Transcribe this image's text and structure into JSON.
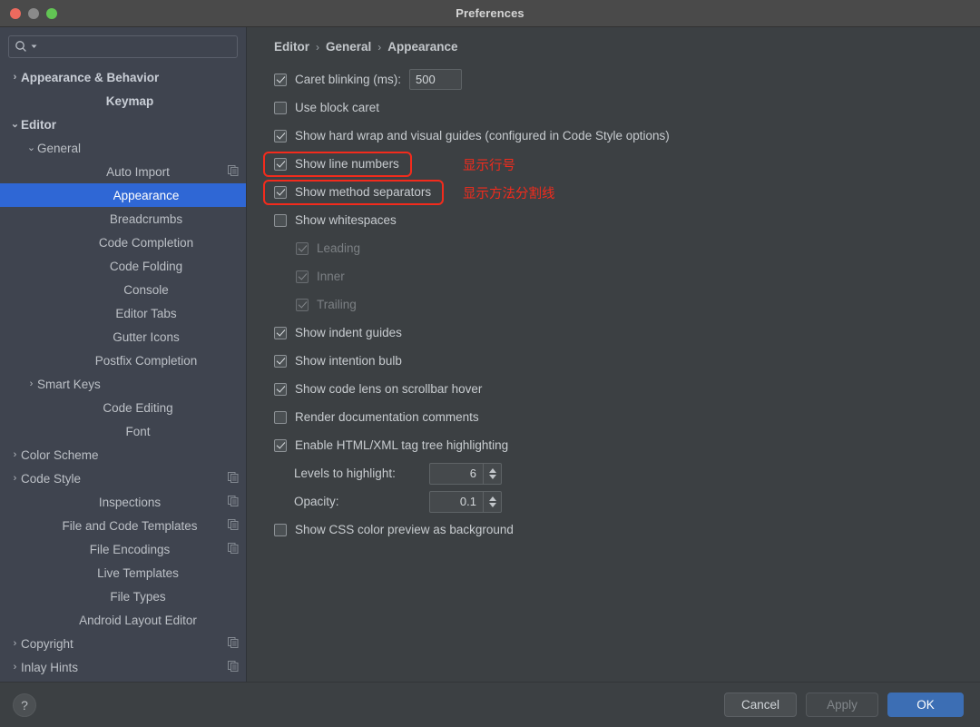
{
  "window": {
    "title": "Preferences",
    "traffic_lights": [
      "close-red",
      "minimize-gray",
      "zoom-green"
    ]
  },
  "sidebar": {
    "search": {
      "value": "",
      "placeholder": ""
    },
    "items": [
      {
        "label": "Appearance & Behavior",
        "indent": 0,
        "arrow": "collapsed",
        "bold": true,
        "selected": false,
        "copy": false
      },
      {
        "label": "Keymap",
        "indent": 0,
        "arrow": "none",
        "bold": true,
        "selected": false,
        "copy": false
      },
      {
        "label": "Editor",
        "indent": 0,
        "arrow": "expanded",
        "bold": true,
        "selected": false,
        "copy": false
      },
      {
        "label": "General",
        "indent": 1,
        "arrow": "expanded",
        "bold": false,
        "selected": false,
        "copy": false
      },
      {
        "label": "Auto Import",
        "indent": 2,
        "arrow": "none",
        "bold": false,
        "selected": false,
        "copy": true
      },
      {
        "label": "Appearance",
        "indent": 2,
        "arrow": "none",
        "bold": false,
        "selected": true,
        "copy": false
      },
      {
        "label": "Breadcrumbs",
        "indent": 2,
        "arrow": "none",
        "bold": false,
        "selected": false,
        "copy": false
      },
      {
        "label": "Code Completion",
        "indent": 2,
        "arrow": "none",
        "bold": false,
        "selected": false,
        "copy": false
      },
      {
        "label": "Code Folding",
        "indent": 2,
        "arrow": "none",
        "bold": false,
        "selected": false,
        "copy": false
      },
      {
        "label": "Console",
        "indent": 2,
        "arrow": "none",
        "bold": false,
        "selected": false,
        "copy": false
      },
      {
        "label": "Editor Tabs",
        "indent": 2,
        "arrow": "none",
        "bold": false,
        "selected": false,
        "copy": false
      },
      {
        "label": "Gutter Icons",
        "indent": 2,
        "arrow": "none",
        "bold": false,
        "selected": false,
        "copy": false
      },
      {
        "label": "Postfix Completion",
        "indent": 2,
        "arrow": "none",
        "bold": false,
        "selected": false,
        "copy": false
      },
      {
        "label": "Smart Keys",
        "indent": 1,
        "arrow": "collapsed",
        "bold": false,
        "selected": false,
        "copy": false
      },
      {
        "label": "Code Editing",
        "indent": 1,
        "arrow": "none",
        "bold": false,
        "selected": false,
        "copy": false
      },
      {
        "label": "Font",
        "indent": 1,
        "arrow": "none",
        "bold": false,
        "selected": false,
        "copy": false
      },
      {
        "label": "Color Scheme",
        "indent": 0,
        "arrow": "collapsed",
        "bold": false,
        "selected": false,
        "copy": false
      },
      {
        "label": "Code Style",
        "indent": 0,
        "arrow": "collapsed",
        "bold": false,
        "selected": false,
        "copy": true
      },
      {
        "label": "Inspections",
        "indent": 1,
        "arrow": "none",
        "bold": false,
        "selected": false,
        "copy": true
      },
      {
        "label": "File and Code Templates",
        "indent": 1,
        "arrow": "none",
        "bold": false,
        "selected": false,
        "copy": true
      },
      {
        "label": "File Encodings",
        "indent": 1,
        "arrow": "none",
        "bold": false,
        "selected": false,
        "copy": true
      },
      {
        "label": "Live Templates",
        "indent": 1,
        "arrow": "none",
        "bold": false,
        "selected": false,
        "copy": false
      },
      {
        "label": "File Types",
        "indent": 1,
        "arrow": "none",
        "bold": false,
        "selected": false,
        "copy": false
      },
      {
        "label": "Android Layout Editor",
        "indent": 1,
        "arrow": "none",
        "bold": false,
        "selected": false,
        "copy": false
      },
      {
        "label": "Copyright",
        "indent": 0,
        "arrow": "collapsed",
        "bold": false,
        "selected": false,
        "copy": true
      },
      {
        "label": "Inlay Hints",
        "indent": 0,
        "arrow": "collapsed",
        "bold": false,
        "selected": false,
        "copy": true
      }
    ]
  },
  "main": {
    "breadcrumb": [
      "Editor",
      "General",
      "Appearance"
    ],
    "breadcrumb_separator": "›",
    "settings": [
      {
        "type": "checkbox-field",
        "label": "Caret blinking (ms):",
        "checked": true,
        "value": "500"
      },
      {
        "type": "checkbox",
        "label": "Use block caret",
        "checked": false,
        "indent": 0,
        "enabled": true
      },
      {
        "type": "checkbox",
        "label": "Show hard wrap and visual guides (configured in Code Style options)",
        "checked": true,
        "indent": 0,
        "enabled": true
      },
      {
        "type": "checkbox",
        "label": "Show line numbers",
        "checked": true,
        "indent": 0,
        "enabled": true,
        "highlighted": true,
        "annotation": "显示行号"
      },
      {
        "type": "checkbox",
        "label": "Show method separators",
        "checked": true,
        "indent": 0,
        "enabled": true,
        "highlighted": true,
        "annotation": "显示方法分割线"
      },
      {
        "type": "checkbox",
        "label": "Show whitespaces",
        "checked": false,
        "indent": 0,
        "enabled": true
      },
      {
        "type": "checkbox",
        "label": "Leading",
        "checked": true,
        "indent": 1,
        "enabled": false
      },
      {
        "type": "checkbox",
        "label": "Inner",
        "checked": true,
        "indent": 1,
        "enabled": false
      },
      {
        "type": "checkbox",
        "label": "Trailing",
        "checked": true,
        "indent": 1,
        "enabled": false
      },
      {
        "type": "checkbox",
        "label": "Show indent guides",
        "checked": true,
        "indent": 0,
        "enabled": true
      },
      {
        "type": "checkbox",
        "label": "Show intention bulb",
        "checked": true,
        "indent": 0,
        "enabled": true
      },
      {
        "type": "checkbox",
        "label": "Show code lens on scrollbar hover",
        "checked": true,
        "indent": 0,
        "enabled": true
      },
      {
        "type": "checkbox",
        "label": "Render documentation comments",
        "checked": false,
        "indent": 0,
        "enabled": true
      },
      {
        "type": "checkbox",
        "label": "Enable HTML/XML tag tree highlighting",
        "checked": true,
        "indent": 0,
        "enabled": true
      },
      {
        "type": "spinner",
        "label": "Levels to highlight:",
        "value": "6"
      },
      {
        "type": "spinner",
        "label": "Opacity:",
        "value": "0.1"
      },
      {
        "type": "checkbox",
        "label": "Show CSS color preview as background",
        "checked": false,
        "indent": 0,
        "enabled": true
      }
    ]
  },
  "footer": {
    "help_label": "?",
    "cancel_label": "Cancel",
    "apply_label": "Apply",
    "ok_label": "OK"
  },
  "colors": {
    "accent_selection": "#2f67d5",
    "primary_button": "#3c6eb4",
    "annotation_red": "#f32b1c",
    "sidebar_bg": "#3f444f",
    "panel_bg": "#3c4043",
    "titlebar_bg": "#4a4a4a"
  }
}
